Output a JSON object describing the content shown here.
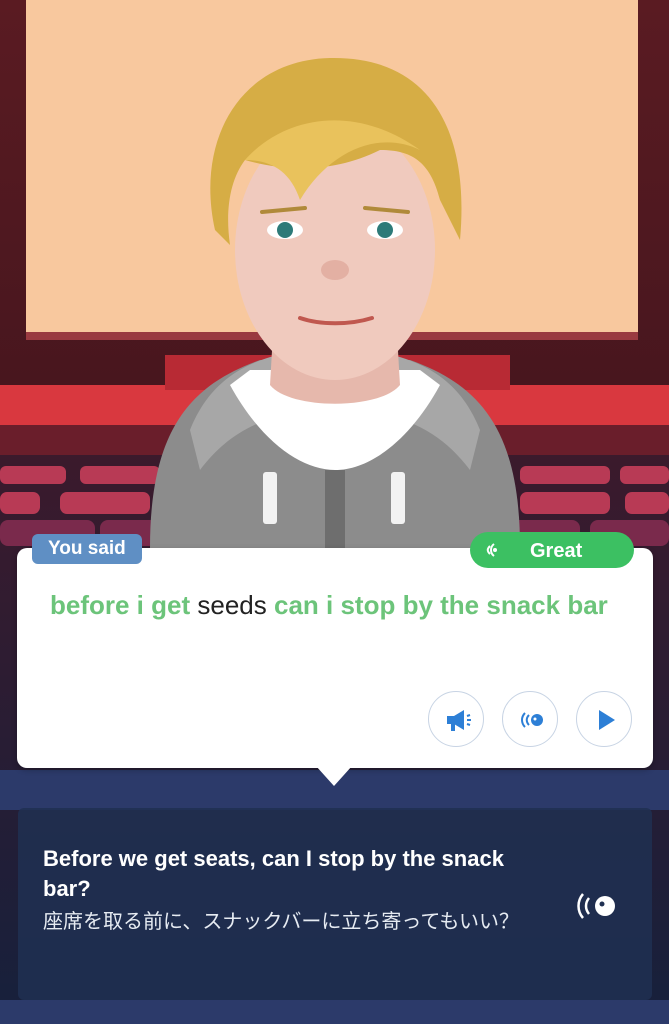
{
  "you_said_label": "You said",
  "rating_label": "Great",
  "said": {
    "w1": "before i get",
    "w2": "seeds",
    "w3": "can i stop by the snack bar"
  },
  "translation": {
    "english": "Before we get seats, can I stop by the snack bar?",
    "japanese": "座席を取る前に、スナックバーに立ち寄ってもいい？"
  },
  "icons": [
    "voice-wave-icon",
    "megaphone-icon",
    "listen-icon",
    "play-icon",
    "speaker-icon"
  ],
  "colors": {
    "good": "#6cc47a",
    "badge": "#3cc062",
    "label_bg": "#5f8fc4",
    "accent": "#2d7fd6"
  }
}
